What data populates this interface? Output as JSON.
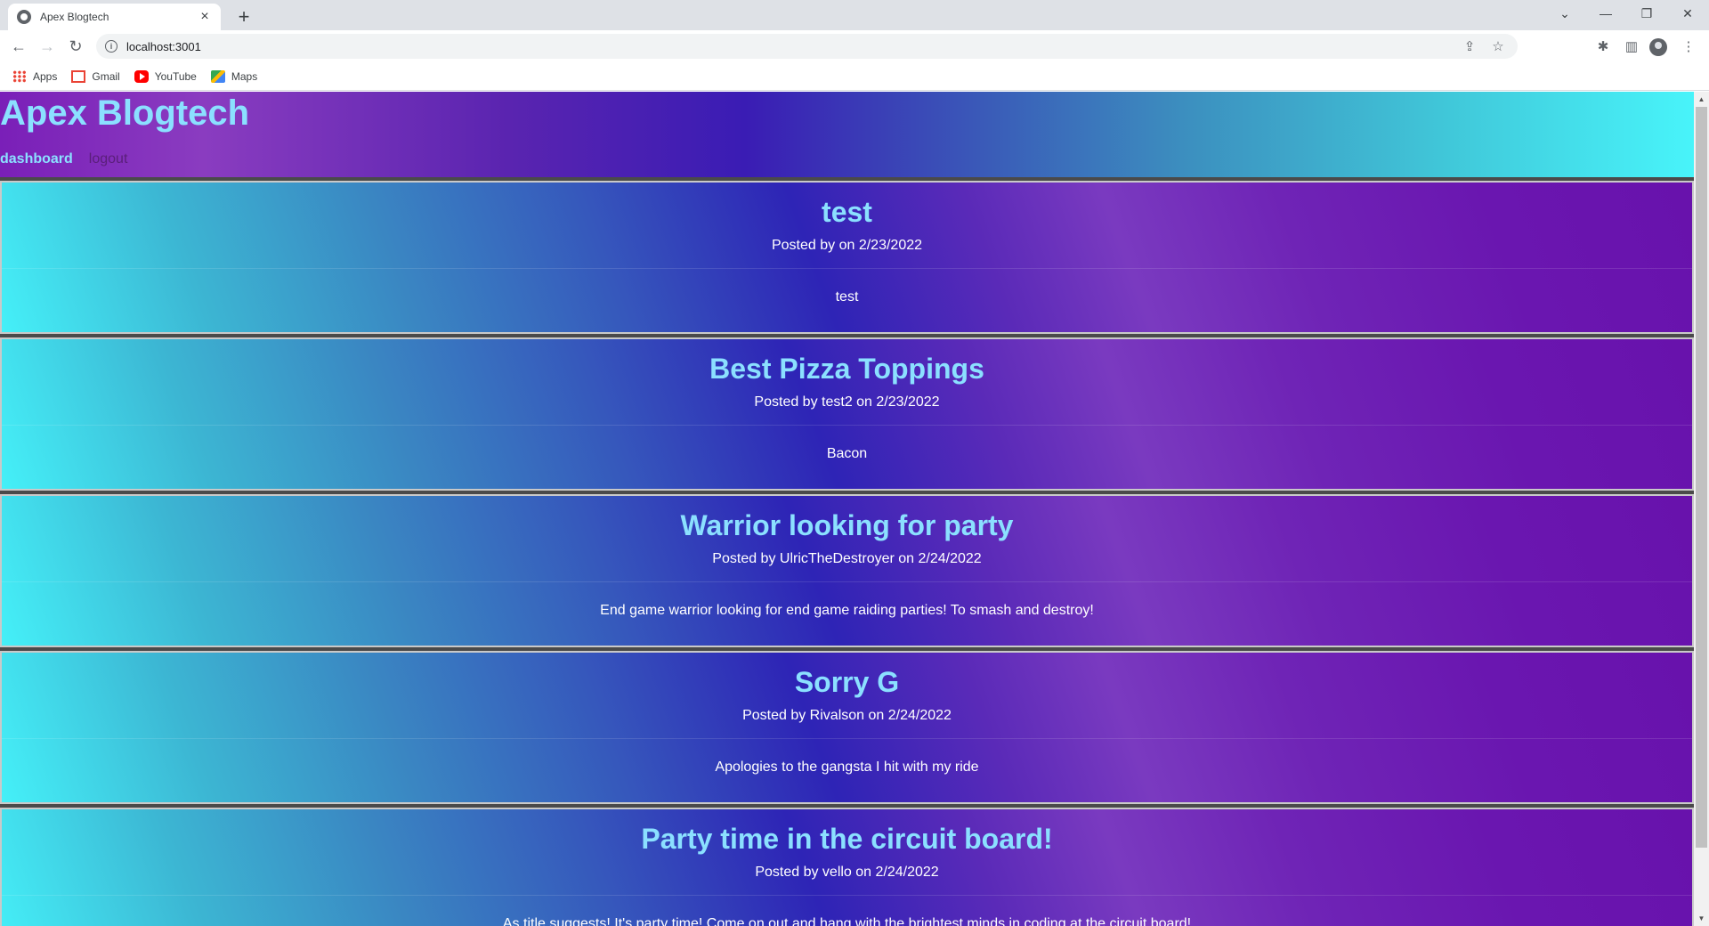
{
  "browser": {
    "tab_title": "Apex Blogtech",
    "tab_close": "×",
    "new_tab": "+",
    "url": "localhost:3001",
    "bookmarks": [
      {
        "label": "Apps",
        "icon": "apps-grid-icon"
      },
      {
        "label": "Gmail",
        "icon": "gmail-icon"
      },
      {
        "label": "YouTube",
        "icon": "youtube-icon"
      },
      {
        "label": "Maps",
        "icon": "maps-icon"
      }
    ]
  },
  "site": {
    "title": "Apex Blogtech",
    "nav": {
      "dashboard": "dashboard",
      "logout": "logout"
    }
  },
  "posts": [
    {
      "title": "test",
      "meta": "Posted by on 2/23/2022",
      "body": "test"
    },
    {
      "title": "Best Pizza Toppings",
      "meta": "Posted by test2 on 2/23/2022",
      "body": "Bacon"
    },
    {
      "title": "Warrior looking for party",
      "meta": "Posted by UlricTheDestroyer on 2/24/2022",
      "body": "End game warrior looking for end game raiding parties! To smash and destroy!"
    },
    {
      "title": "Sorry G",
      "meta": "Posted by Rivalson on 2/24/2022",
      "body": "Apologies to the gangsta I hit with my ride"
    },
    {
      "title": "Party time in the circuit board!",
      "meta": "Posted by vello on 2/24/2022",
      "body": "As title suggests! It's party time! Come on out and hang with the brightest minds in coding at the circuit board!"
    }
  ],
  "colors": {
    "title_accent": "#8be0ff",
    "logout_link": "#5a1f7a",
    "gradient_purple": "#6a16b0",
    "gradient_cyan": "#48f4fa"
  }
}
